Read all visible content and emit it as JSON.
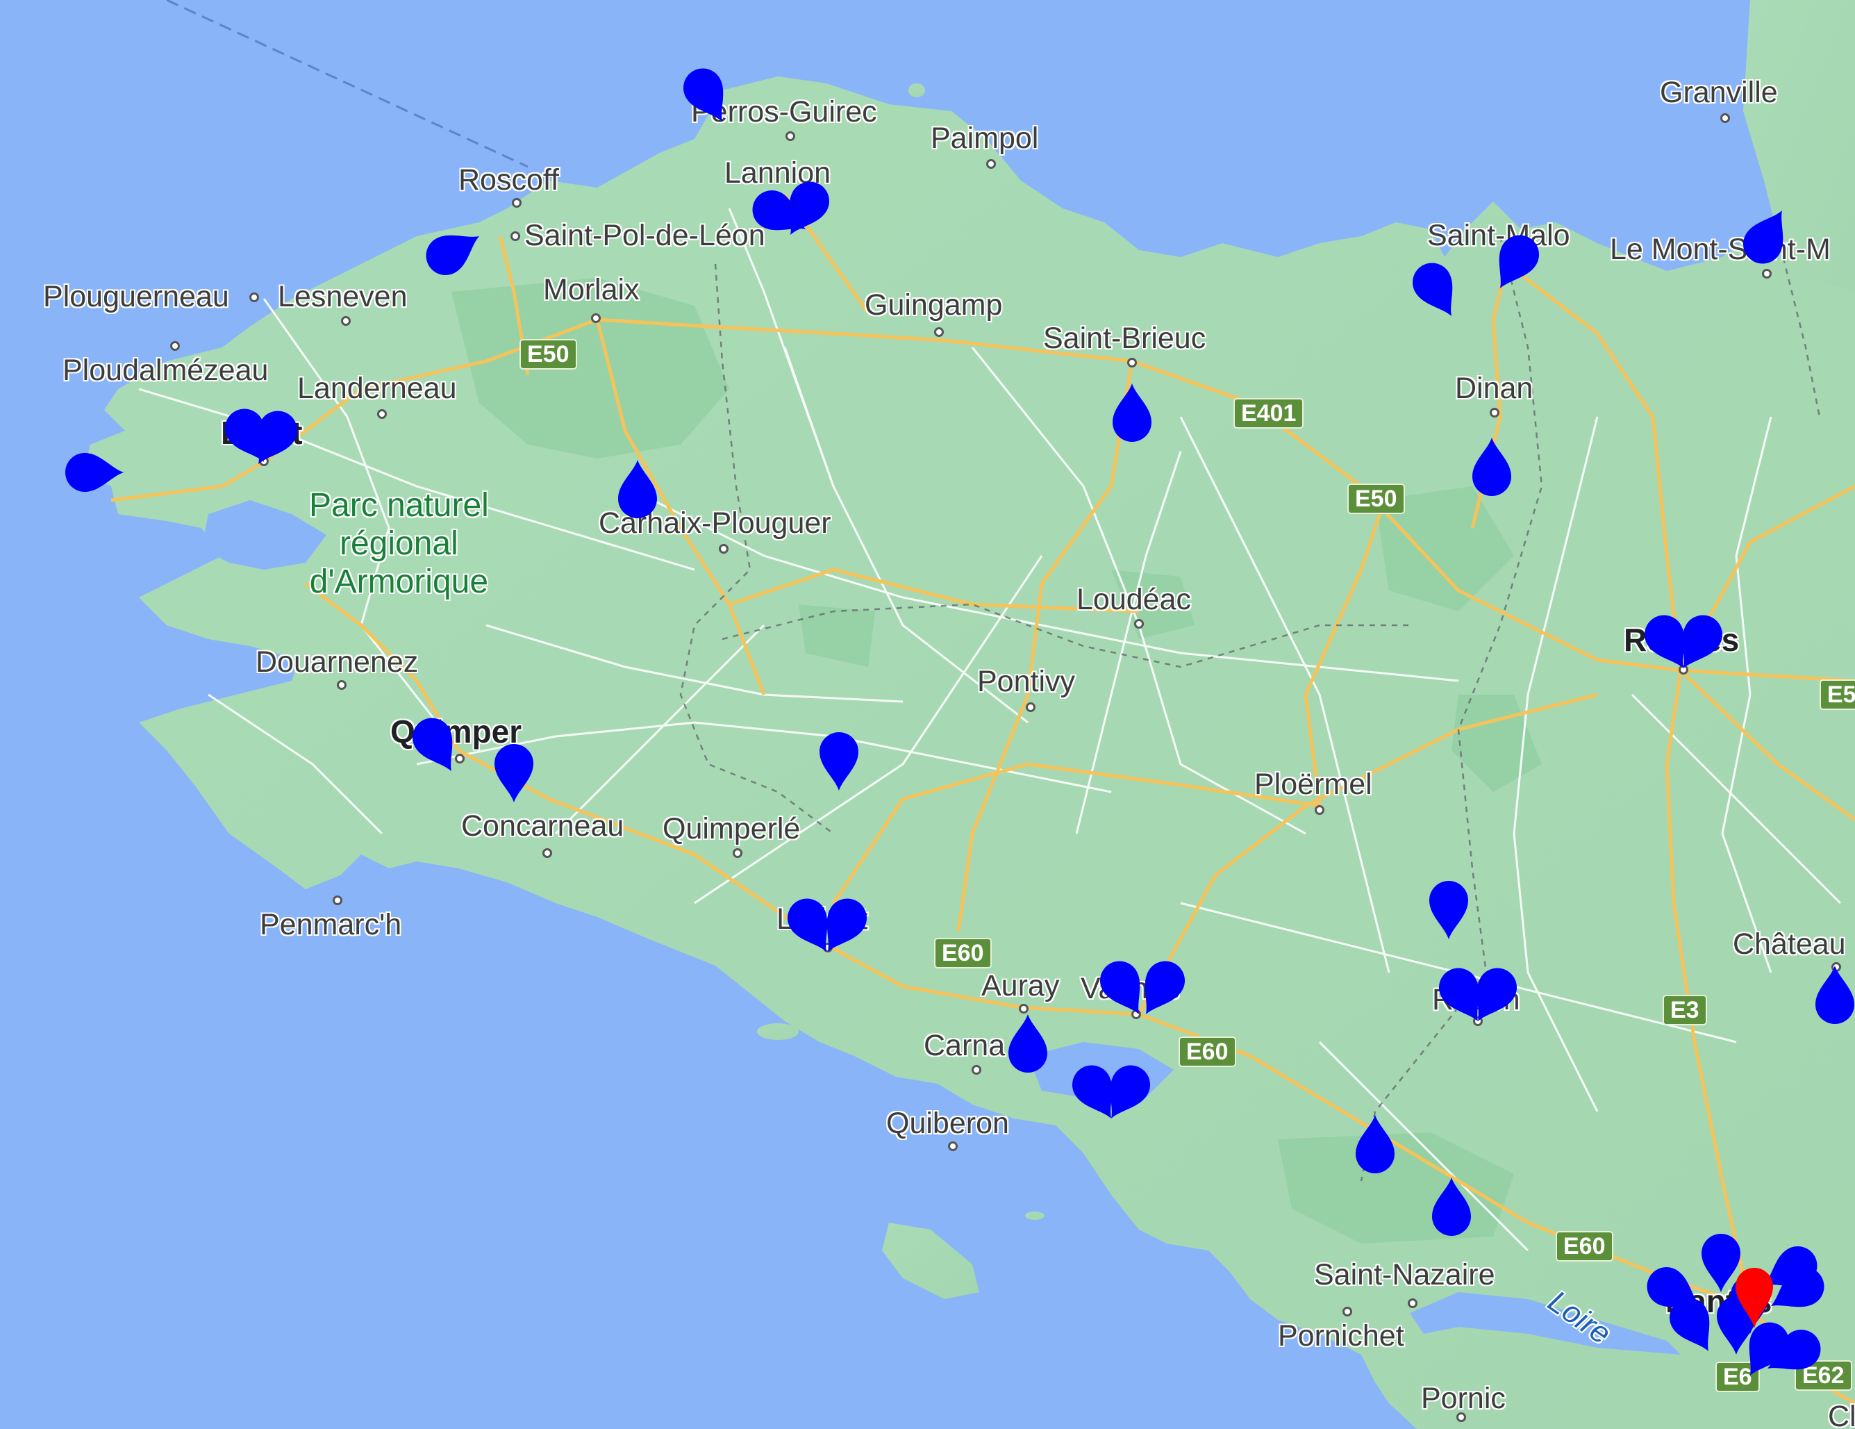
{
  "map": {
    "colors": {
      "sea": "#8ab4f8",
      "land": "#a8dab5",
      "forest": "#94d2a5",
      "roads_major": "#f6c35b",
      "roads_minor": "#ffffff",
      "marker": "#0000ff",
      "selected_marker": "#ff0000"
    },
    "places": [
      {
        "id": "perros",
        "name": "Perros-Guirec",
        "style": "city"
      },
      {
        "id": "paimpol",
        "name": "Paimpol",
        "style": "city"
      },
      {
        "id": "granville",
        "name": "Granville",
        "style": "city"
      },
      {
        "id": "roscoff",
        "name": "Roscoff",
        "style": "city"
      },
      {
        "id": "lannion",
        "name": "Lannion",
        "style": "city"
      },
      {
        "id": "stpol",
        "name": "Saint-Pol-de-Léon",
        "style": "city"
      },
      {
        "id": "stmalo",
        "name": "Saint-Malo",
        "style": "city"
      },
      {
        "id": "montstm",
        "name": "Le Mont-Saint-M",
        "style": "city"
      },
      {
        "id": "plouguerneau",
        "name": "Plouguerneau",
        "style": "city"
      },
      {
        "id": "lesneven",
        "name": "Lesneven",
        "style": "city"
      },
      {
        "id": "morlaix",
        "name": "Morlaix",
        "style": "city"
      },
      {
        "id": "guingamp",
        "name": "Guingamp",
        "style": "city"
      },
      {
        "id": "stbrieuc",
        "name": "Saint-Brieuc",
        "style": "city"
      },
      {
        "id": "ploudal",
        "name": "Ploudalmézeau",
        "style": "city"
      },
      {
        "id": "landerneau",
        "name": "Landerneau",
        "style": "city"
      },
      {
        "id": "dinan",
        "name": "Dinan",
        "style": "city"
      },
      {
        "id": "brest",
        "name": "Brest",
        "style": "major"
      },
      {
        "id": "carhaix",
        "name": "Carhaix-Plouguer",
        "style": "city"
      },
      {
        "id": "loudeac",
        "name": "Loudéac",
        "style": "city"
      },
      {
        "id": "rennes",
        "name": "Rennes",
        "style": "major"
      },
      {
        "id": "douarnenez",
        "name": "Douarnenez",
        "style": "city"
      },
      {
        "id": "pontivy",
        "name": "Pontivy",
        "style": "city"
      },
      {
        "id": "quimper",
        "name": "Quimper",
        "style": "major"
      },
      {
        "id": "ploermel",
        "name": "Ploërmel",
        "style": "city"
      },
      {
        "id": "concarneau",
        "name": "Concarneau",
        "style": "city"
      },
      {
        "id": "quimperle",
        "name": "Quimperlé",
        "style": "city"
      },
      {
        "id": "lorient",
        "name": "Lorient",
        "style": "city"
      },
      {
        "id": "penmarch",
        "name": "Penmarc'h",
        "style": "city"
      },
      {
        "id": "chateau",
        "name": "Château",
        "style": "city"
      },
      {
        "id": "auray",
        "name": "Auray",
        "style": "city"
      },
      {
        "id": "vannes",
        "name": "Vannes",
        "style": "city"
      },
      {
        "id": "redon",
        "name": "Redon",
        "style": "city"
      },
      {
        "id": "carnac",
        "name": "Carna",
        "style": "city"
      },
      {
        "id": "quiberon",
        "name": "Quiberon",
        "style": "city"
      },
      {
        "id": "stnazaire",
        "name": "Saint-Nazaire",
        "style": "city"
      },
      {
        "id": "pornichet",
        "name": "Pornichet",
        "style": "city"
      },
      {
        "id": "pornic",
        "name": "Pornic",
        "style": "city"
      },
      {
        "id": "nantes",
        "name": "Nantes",
        "style": "major"
      },
      {
        "id": "cl",
        "name": "Cl",
        "style": "city"
      }
    ],
    "park_label": "Parc naturel\nrégional\nd'Armorique",
    "river_label": "Loire",
    "road_shields": [
      "E50",
      "E401",
      "E50",
      "E5",
      "E60",
      "E60",
      "E3",
      "E60",
      "E62",
      "E6"
    ],
    "markers_count": 44,
    "selected_marker_count": 1
  }
}
